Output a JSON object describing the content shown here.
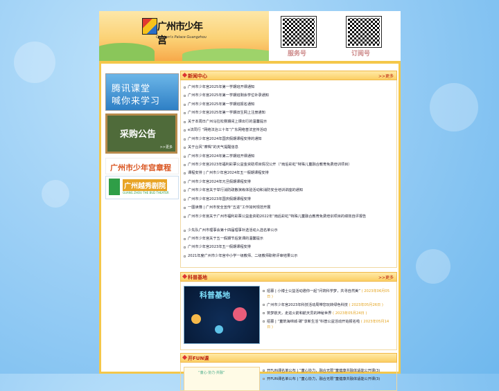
{
  "header": {
    "logo_cn": "广州市少年宫",
    "logo_en": "Children's Palace Guangzhou",
    "qr_service_label": "服务号",
    "qr_subscribe_label": "订阅号"
  },
  "sidebar": {
    "ad1_line1": "腾讯课堂",
    "ad1_line2": "喊你来学习",
    "ad2_title": "采购公告",
    "ad2_more": ">>更多",
    "ad3_title": "广州市少年宫章程",
    "ad4_title": "广州越秀剧院",
    "ad4_en": "GUANG ZHOU THE BUD THEATER"
  },
  "news": {
    "title": "新闻中心",
    "more": ">>更多",
    "items": [
      "广州市少年宫2025年第一学期班开课通知",
      "广州市少年宫2025年第一学期班剩余学位补录通知",
      "广州市少年宫2025年第一学期班报名通知",
      "广州市少年宫2025年第一学期旧生网上注册通知",
      "关于本周日广州马拉松赛期间上课出行的温馨提示",
      "e法同行 “网络法治三十年”广东网络普法宣传活动",
      "广州市少年宫2024年国庆假期课程安排的通知",
      "关于台风“摩羯”的天气提醒信息",
      "广州市少年宫2024年第二学期班开课通知",
      "广州市少年宫2023年福利彩票公益金资助项目情况公开（“雨后彩虹”特殊儿童融合教育免费培训项目）",
      "课程安排 | 广州市少年宫2024年五一假期课程安排",
      "广州市少年宫2024年元旦假期课程安排",
      "广州市少年宫关于举行消防疏散演练体验活动和消防安全培训讲座的通知",
      "广州市少年宫2023年国庆假期课程安排",
      "一图读懂 | 广州市安全宣传“五进”工作如何规范开展",
      "广州市少年宫关于广州市福利彩票公益金资助2022年“雨后彩虹”特殊儿童融合教育免费培训项目的绩效自评报告",
      "少先队广州市理事会第十四届理事补选活动入选名单公示",
      "广州市少年宫关于五一假期节后复课的温馨提示",
      "广州市少年宫2023年五一假期课程安排",
      "2021年度广州市少年宫中小学一级教师、二级教师职称评审结果公示"
    ]
  },
  "science": {
    "title": "科普基地",
    "more": ">>更多",
    "image_title": "科普基地",
    "items": [
      {
        "text": "招募 | 小博士公益活动邀你一起“问筑科学梦，共寻自然美”",
        "date": "( 2023年06月05日 )"
      },
      {
        "text": "广州市少年宫2023年科技活动周带您玩转绿色科技",
        "date": "( 2023年05月26日 )"
      },
      {
        "text": "筑梦航天，走进火箭和航天员的神秘世界",
        "date": "( 2023年05月24日 )"
      },
      {
        "text": "招募 | “童筑海绵城·碳”享新生活”科普公益活动开始报名啦",
        "date": "( 2023年05月14日 )"
      }
    ]
  },
  "fun": {
    "title": "开FUN课",
    "image_caption": "“童心·协力·共融”",
    "items": [
      "开FUN课名单公布 | “童心协力，融合无限”童健康共融体适能公开课(3)",
      "开FUN课名单公布 | “童心协力，融合无限”童健康共融体适能公开课(3)"
    ]
  }
}
